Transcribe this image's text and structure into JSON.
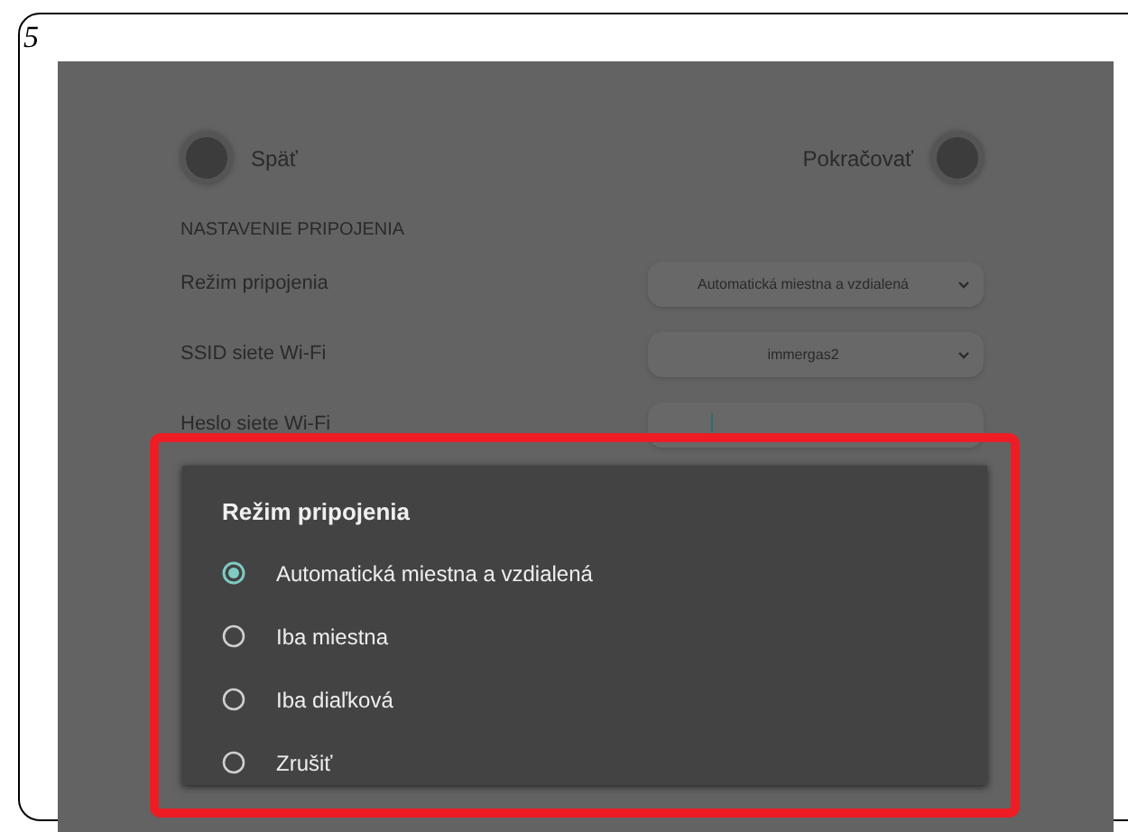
{
  "figure_number": "5",
  "screen": {
    "back_button": {
      "label": "Späť"
    },
    "continue_button": {
      "label": "Pokračovať"
    },
    "section_title": "NASTAVENIE PRIPOJENIA",
    "fields": [
      {
        "kind": "select",
        "label": "Režim pripojenia",
        "value": "Automatická miestna a vzdialená"
      },
      {
        "kind": "select",
        "label": "SSID siete Wi-Fi",
        "value": "immergas2"
      },
      {
        "kind": "text",
        "label": "Heslo siete Wi-Fi"
      }
    ]
  },
  "dialog": {
    "title": "Režim pripojenia",
    "highlighted": true,
    "options": [
      {
        "label": "Automatická miestna a vzdialená",
        "selected": true
      },
      {
        "label": "Iba miestna",
        "selected": false
      },
      {
        "label": "Iba diaľková",
        "selected": false
      },
      {
        "label": "Zrušiť",
        "selected": false
      }
    ]
  }
}
